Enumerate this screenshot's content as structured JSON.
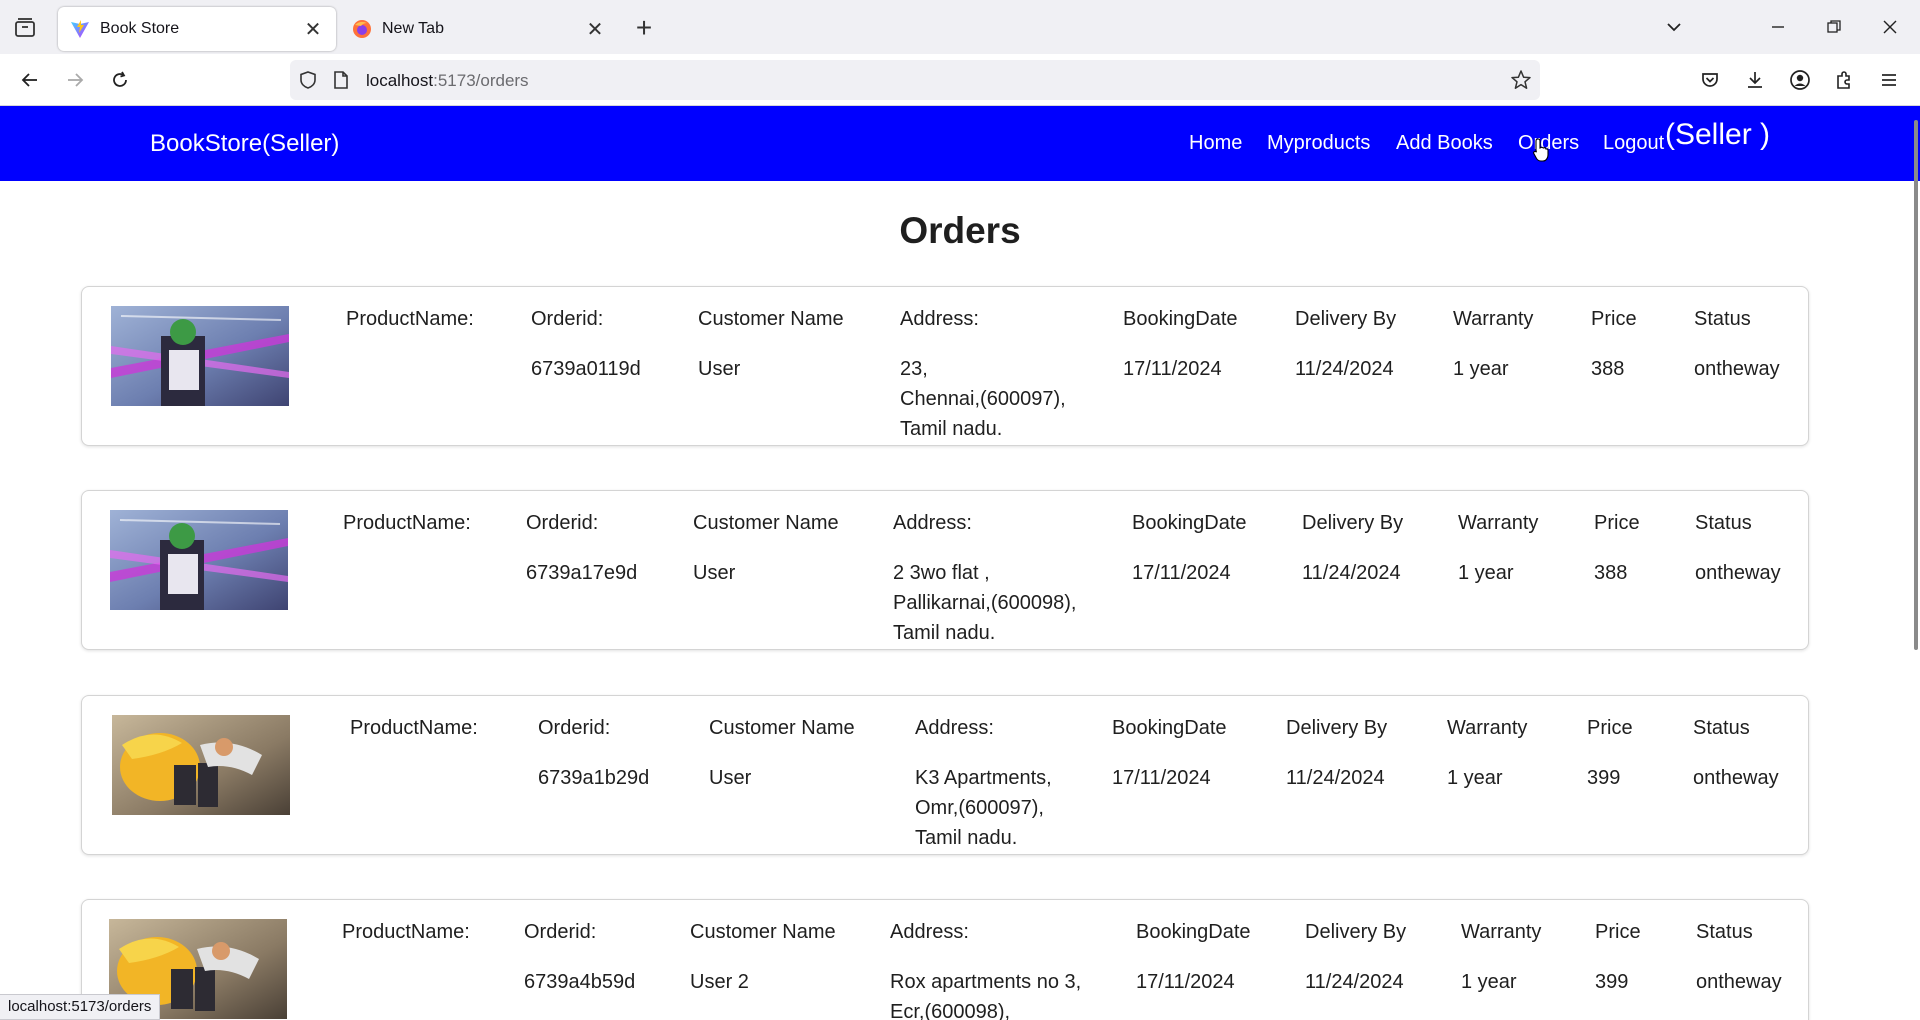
{
  "browser": {
    "tabs": [
      {
        "title": "Book Store",
        "active": true
      },
      {
        "title": "New Tab",
        "active": false
      }
    ],
    "url_host": "localhost",
    "url_path": ":5173/orders",
    "status_url": "localhost:5173/orders"
  },
  "header": {
    "brand": "BookStore(Seller)",
    "nav": [
      "Home",
      "Myproducts",
      "Add Books",
      "Orders",
      "Logout"
    ],
    "role": "(Seller )",
    "bg_color": "#0000ff"
  },
  "page": {
    "title": "Orders",
    "labels": {
      "product_name": "ProductName:",
      "order_id": "Orderid:",
      "customer": "Customer Name",
      "address": "Address:",
      "booking_date": "BookingDate",
      "delivery_by": "Delivery By",
      "warranty": "Warranty",
      "price": "Price",
      "status": "Status"
    }
  },
  "orders": [
    {
      "image": "green-swordsman-art",
      "order_id": "6739a0119d",
      "customer": "User",
      "address": [
        "23,",
        "Chennai,(600097),",
        "Tamil nadu."
      ],
      "booking_date": "17/11/2024",
      "delivery_by": "11/24/2024",
      "warranty": "1 year",
      "price": "388",
      "status": "ontheway"
    },
    {
      "image": "green-swordsman-art",
      "order_id": "6739a17e9d",
      "customer": "User",
      "address": [
        "2 3wo flat ,",
        "Pallikarnai,(600098),",
        "Tamil nadu."
      ],
      "booking_date": "17/11/2024",
      "delivery_by": "11/24/2024",
      "warranty": "1 year",
      "price": "388",
      "status": "ontheway"
    },
    {
      "image": "orange-warrior-art",
      "order_id": "6739a1b29d",
      "customer": "User",
      "address": [
        "K3 Apartments,",
        "Omr,(600097),",
        "Tamil nadu."
      ],
      "booking_date": "17/11/2024",
      "delivery_by": "11/24/2024",
      "warranty": "1 year",
      "price": "399",
      "status": "ontheway"
    },
    {
      "image": "orange-warrior-art",
      "order_id": "6739a4b59d",
      "customer": "User 2",
      "address": [
        "Rox apartments no 3,",
        "Ecr,(600098),"
      ],
      "booking_date": "17/11/2024",
      "delivery_by": "11/24/2024",
      "warranty": "1 year",
      "price": "399",
      "status": "ontheway"
    }
  ]
}
